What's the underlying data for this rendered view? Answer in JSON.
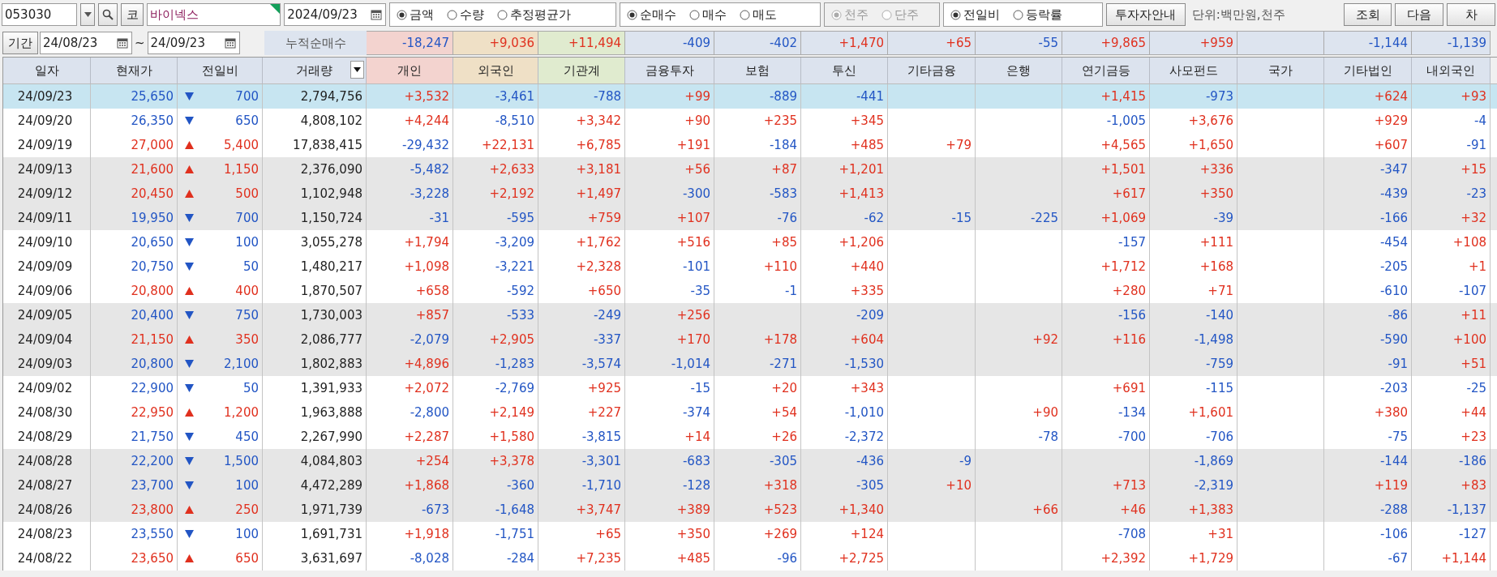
{
  "toolbar": {
    "code": "053030",
    "code_button": "코",
    "name": "바이넥스",
    "date": "2024/09/23",
    "option_groups": [
      {
        "disabled": false,
        "options": [
          {
            "label": "금액",
            "selected": true
          },
          {
            "label": "수량",
            "selected": false
          },
          {
            "label": "추정평균가",
            "selected": false
          }
        ]
      },
      {
        "disabled": false,
        "options": [
          {
            "label": "순매수",
            "selected": true
          },
          {
            "label": "매수",
            "selected": false
          },
          {
            "label": "매도",
            "selected": false
          }
        ]
      },
      {
        "disabled": true,
        "options": [
          {
            "label": "천주",
            "selected": true
          },
          {
            "label": "단주",
            "selected": false
          }
        ]
      },
      {
        "disabled": false,
        "options": [
          {
            "label": "전일비",
            "selected": true
          },
          {
            "label": "등락률",
            "selected": false
          }
        ]
      }
    ],
    "guide_button": "투자자안내",
    "unit": "단위:백만원,천주",
    "buttons": [
      "조회",
      "다음",
      "차"
    ]
  },
  "period": {
    "button": "기간",
    "from": "24/08/23",
    "separator": "~",
    "to": "24/09/23",
    "total_label": "누적순매수"
  },
  "table": {
    "columns": [
      {
        "label": "일자"
      },
      {
        "label": "현재가"
      },
      {
        "label": "전일비"
      },
      {
        "label": "거래량"
      },
      {
        "label": "개인",
        "color": "#f3d3cf",
        "total": "-18,247"
      },
      {
        "label": "외국인",
        "color": "#efe0c6",
        "total": "+9,036"
      },
      {
        "label": "기관계",
        "color": "#e0ebcf",
        "total": "+11,494"
      },
      {
        "label": "금융투자",
        "total": "-409"
      },
      {
        "label": "보험",
        "total": "-402"
      },
      {
        "label": "투신",
        "total": "+1,470"
      },
      {
        "label": "기타금융",
        "total": "+65"
      },
      {
        "label": "은행",
        "total": "-55"
      },
      {
        "label": "연기금등",
        "total": "+9,865"
      },
      {
        "label": "사모펀드",
        "total": "+959"
      },
      {
        "label": "국가"
      },
      {
        "label": "기타법인",
        "total": "-1,144"
      },
      {
        "label": "내외국인",
        "total": "-1,139"
      }
    ],
    "rows": [
      {
        "date": "24/09/23",
        "price": "25,650",
        "up": false,
        "change": "700",
        "volume": "2,794,756",
        "selected": true,
        "shaded": false,
        "individual": "+3,532",
        "foreign": "-3,461",
        "institution": "-788",
        "financial_investment": "+99",
        "insurance": "-889",
        "investment_trust": "-441",
        "pension": "+1,415",
        "private_equity": "-973",
        "other_corporation": "+624",
        "domestic_foreign": "+93"
      },
      {
        "date": "24/09/20",
        "price": "26,350",
        "up": false,
        "change": "650",
        "volume": "4,808,102",
        "selected": false,
        "shaded": false,
        "individual": "+4,244",
        "foreign": "-8,510",
        "institution": "+3,342",
        "financial_investment": "+90",
        "insurance": "+235",
        "investment_trust": "+345",
        "pension": "-1,005",
        "private_equity": "+3,676",
        "other_corporation": "+929",
        "domestic_foreign": "-4"
      },
      {
        "date": "24/09/19",
        "price": "27,000",
        "up": true,
        "change": "5,400",
        "volume": "17,838,415",
        "selected": false,
        "shaded": false,
        "individual": "-29,432",
        "foreign": "+22,131",
        "institution": "+6,785",
        "financial_investment": "+191",
        "insurance": "-184",
        "investment_trust": "+485",
        "other_finance": "+79",
        "pension": "+4,565",
        "private_equity": "+1,650",
        "other_corporation": "+607",
        "domestic_foreign": "-91"
      },
      {
        "date": "24/09/13",
        "price": "21,600",
        "up": true,
        "change": "1,150",
        "volume": "2,376,090",
        "selected": false,
        "shaded": true,
        "individual": "-5,482",
        "foreign": "+2,633",
        "institution": "+3,181",
        "financial_investment": "+56",
        "insurance": "+87",
        "investment_trust": "+1,201",
        "pension": "+1,501",
        "private_equity": "+336",
        "other_corporation": "-347",
        "domestic_foreign": "+15"
      },
      {
        "date": "24/09/12",
        "price": "20,450",
        "up": true,
        "change": "500",
        "volume": "1,102,948",
        "selected": false,
        "shaded": true,
        "individual": "-3,228",
        "foreign": "+2,192",
        "institution": "+1,497",
        "financial_investment": "-300",
        "insurance": "-583",
        "investment_trust": "+1,413",
        "pension": "+617",
        "private_equity": "+350",
        "other_corporation": "-439",
        "domestic_foreign": "-23"
      },
      {
        "date": "24/09/11",
        "price": "19,950",
        "up": false,
        "change": "700",
        "volume": "1,150,724",
        "selected": false,
        "shaded": true,
        "individual": "-31",
        "foreign": "-595",
        "institution": "+759",
        "financial_investment": "+107",
        "insurance": "-76",
        "investment_trust": "-62",
        "other_finance": "-15",
        "bank": "-225",
        "pension": "+1,069",
        "private_equity": "-39",
        "other_corporation": "-166",
        "domestic_foreign": "+32"
      },
      {
        "date": "24/09/10",
        "price": "20,650",
        "up": false,
        "change": "100",
        "volume": "3,055,278",
        "selected": false,
        "shaded": false,
        "individual": "+1,794",
        "foreign": "-3,209",
        "institution": "+1,762",
        "financial_investment": "+516",
        "insurance": "+85",
        "investment_trust": "+1,206",
        "pension": "-157",
        "private_equity": "+111",
        "other_corporation": "-454",
        "domestic_foreign": "+108"
      },
      {
        "date": "24/09/09",
        "price": "20,750",
        "up": false,
        "change": "50",
        "volume": "1,480,217",
        "selected": false,
        "shaded": false,
        "individual": "+1,098",
        "foreign": "-3,221",
        "institution": "+2,328",
        "financial_investment": "-101",
        "insurance": "+110",
        "investment_trust": "+440",
        "pension": "+1,712",
        "private_equity": "+168",
        "other_corporation": "-205",
        "domestic_foreign": "+1"
      },
      {
        "date": "24/09/06",
        "price": "20,800",
        "up": true,
        "change": "400",
        "volume": "1,870,507",
        "selected": false,
        "shaded": false,
        "individual": "+658",
        "foreign": "-592",
        "institution": "+650",
        "financial_investment": "-35",
        "insurance": "-1",
        "investment_trust": "+335",
        "pension": "+280",
        "private_equity": "+71",
        "other_corporation": "-610",
        "domestic_foreign": "-107"
      },
      {
        "date": "24/09/05",
        "price": "20,400",
        "up": false,
        "change": "750",
        "volume": "1,730,003",
        "selected": false,
        "shaded": true,
        "individual": "+857",
        "foreign": "-533",
        "institution": "-249",
        "financial_investment": "+256",
        "investment_trust": "-209",
        "pension": "-156",
        "private_equity": "-140",
        "other_corporation": "-86",
        "domestic_foreign": "+11"
      },
      {
        "date": "24/09/04",
        "price": "21,150",
        "up": true,
        "change": "350",
        "volume": "2,086,777",
        "selected": false,
        "shaded": true,
        "individual": "-2,079",
        "foreign": "+2,905",
        "institution": "-337",
        "financial_investment": "+170",
        "insurance": "+178",
        "investment_trust": "+604",
        "bank": "+92",
        "pension": "+116",
        "private_equity": "-1,498",
        "other_corporation": "-590",
        "domestic_foreign": "+100"
      },
      {
        "date": "24/09/03",
        "price": "20,800",
        "up": false,
        "change": "2,100",
        "volume": "1,802,883",
        "selected": false,
        "shaded": true,
        "individual": "+4,896",
        "foreign": "-1,283",
        "institution": "-3,574",
        "financial_investment": "-1,014",
        "insurance": "-271",
        "investment_trust": "-1,530",
        "private_equity": "-759",
        "other_corporation": "-91",
        "domestic_foreign": "+51"
      },
      {
        "date": "24/09/02",
        "price": "22,900",
        "up": false,
        "change": "50",
        "volume": "1,391,933",
        "selected": false,
        "shaded": false,
        "individual": "+2,072",
        "foreign": "-2,769",
        "institution": "+925",
        "financial_investment": "-15",
        "insurance": "+20",
        "investment_trust": "+343",
        "pension": "+691",
        "private_equity": "-115",
        "other_corporation": "-203",
        "domestic_foreign": "-25"
      },
      {
        "date": "24/08/30",
        "price": "22,950",
        "up": true,
        "change": "1,200",
        "volume": "1,963,888",
        "selected": false,
        "shaded": false,
        "individual": "-2,800",
        "foreign": "+2,149",
        "institution": "+227",
        "financial_investment": "-374",
        "insurance": "+54",
        "investment_trust": "-1,010",
        "bank": "+90",
        "pension": "-134",
        "private_equity": "+1,601",
        "other_corporation": "+380",
        "domestic_foreign": "+44"
      },
      {
        "date": "24/08/29",
        "price": "21,750",
        "up": false,
        "change": "450",
        "volume": "2,267,990",
        "selected": false,
        "shaded": false,
        "individual": "+2,287",
        "foreign": "+1,580",
        "institution": "-3,815",
        "financial_investment": "+14",
        "insurance": "+26",
        "investment_trust": "-2,372",
        "bank": "-78",
        "pension": "-700",
        "private_equity": "-706",
        "other_corporation": "-75",
        "domestic_foreign": "+23"
      },
      {
        "date": "24/08/28",
        "price": "22,200",
        "up": false,
        "change": "1,500",
        "volume": "4,084,803",
        "selected": false,
        "shaded": true,
        "individual": "+254",
        "foreign": "+3,378",
        "institution": "-3,301",
        "financial_investment": "-683",
        "insurance": "-305",
        "investment_trust": "-436",
        "other_finance": "-9",
        "private_equity": "-1,869",
        "other_corporation": "-144",
        "domestic_foreign": "-186"
      },
      {
        "date": "24/08/27",
        "price": "23,700",
        "up": false,
        "change": "100",
        "volume": "4,472,289",
        "selected": false,
        "shaded": true,
        "individual": "+1,868",
        "foreign": "-360",
        "institution": "-1,710",
        "financial_investment": "-128",
        "insurance": "+318",
        "investment_trust": "-305",
        "other_finance": "+10",
        "pension": "+713",
        "private_equity": "-2,319",
        "other_corporation": "+119",
        "domestic_foreign": "+83"
      },
      {
        "date": "24/08/26",
        "price": "23,800",
        "up": true,
        "change": "250",
        "volume": "1,971,739",
        "selected": false,
        "shaded": true,
        "individual": "-673",
        "foreign": "-1,648",
        "institution": "+3,747",
        "financial_investment": "+389",
        "insurance": "+523",
        "investment_trust": "+1,340",
        "bank": "+66",
        "pension": "+46",
        "private_equity": "+1,383",
        "other_corporation": "-288",
        "domestic_foreign": "-1,137"
      },
      {
        "date": "24/08/23",
        "price": "23,550",
        "up": false,
        "change": "100",
        "volume": "1,691,731",
        "selected": false,
        "shaded": false,
        "individual": "+1,918",
        "foreign": "-1,751",
        "institution": "+65",
        "financial_investment": "+350",
        "insurance": "+269",
        "investment_trust": "+124",
        "pension": "-708",
        "private_equity": "+31",
        "other_corporation": "-106",
        "domestic_foreign": "-127"
      },
      {
        "date": "24/08/22",
        "price": "23,650",
        "up": true,
        "change": "650",
        "volume": "3,631,697",
        "selected": false,
        "shaded": false,
        "individual": "-8,028",
        "foreign": "-284",
        "institution": "+7,235",
        "financial_investment": "+485",
        "insurance": "-96",
        "investment_trust": "+2,725",
        "pension": "+2,392",
        "private_equity": "+1,729",
        "other_corporation": "-67",
        "domestic_foreign": "+1,144"
      }
    ]
  }
}
